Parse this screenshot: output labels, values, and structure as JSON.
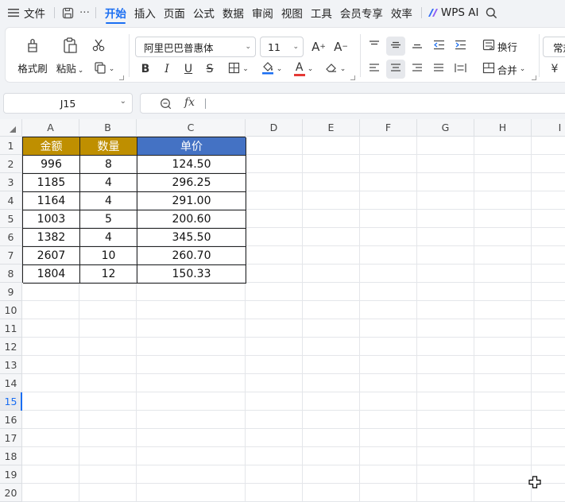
{
  "menubar": {
    "file_label": "文件",
    "more_label": "···",
    "tabs": [
      {
        "label": "开始",
        "active": true
      },
      {
        "label": "插入"
      },
      {
        "label": "页面"
      },
      {
        "label": "公式"
      },
      {
        "label": "数据"
      },
      {
        "label": "审阅"
      },
      {
        "label": "视图"
      },
      {
        "label": "工具"
      },
      {
        "label": "会员专享"
      },
      {
        "label": "效率"
      }
    ],
    "wps_ai_label": "WPS AI"
  },
  "ribbon": {
    "format_painter_label": "格式刷",
    "paste_label": "粘贴",
    "font_name": "阿里巴巴普惠体",
    "font_size": "11",
    "bold": "B",
    "italic": "I",
    "underline": "U",
    "strike": "S",
    "font_color_glyph": "A",
    "wrap_label": "换行",
    "merge_label": "合并",
    "number_format_partial": "常规",
    "currency_symbol": "¥"
  },
  "formula_bar": {
    "name_box": "J15",
    "fx_label": "fx",
    "formula": ""
  },
  "sheet": {
    "columns": [
      "A",
      "B",
      "C",
      "D",
      "E",
      "F",
      "G",
      "H",
      "I"
    ],
    "rows": [
      "1",
      "2",
      "3",
      "4",
      "5",
      "6",
      "7",
      "8",
      "9",
      "10",
      "11",
      "12",
      "13",
      "14",
      "15",
      "16",
      "17",
      "18",
      "19",
      "20"
    ],
    "selected_row": "15",
    "headers": [
      "金额",
      "数量",
      "单价"
    ],
    "header_colors": {
      "gold": "#bf8f00",
      "blue": "#4472c4"
    },
    "data": [
      [
        "996",
        "8",
        "124.50"
      ],
      [
        "1185",
        "4",
        "296.25"
      ],
      [
        "1164",
        "4",
        "291.00"
      ],
      [
        "1003",
        "5",
        "200.60"
      ],
      [
        "1382",
        "4",
        "345.50"
      ],
      [
        "2607",
        "10",
        "260.70"
      ],
      [
        "1804",
        "12",
        "150.33"
      ]
    ]
  },
  "accent_color": "#1a6ef2"
}
